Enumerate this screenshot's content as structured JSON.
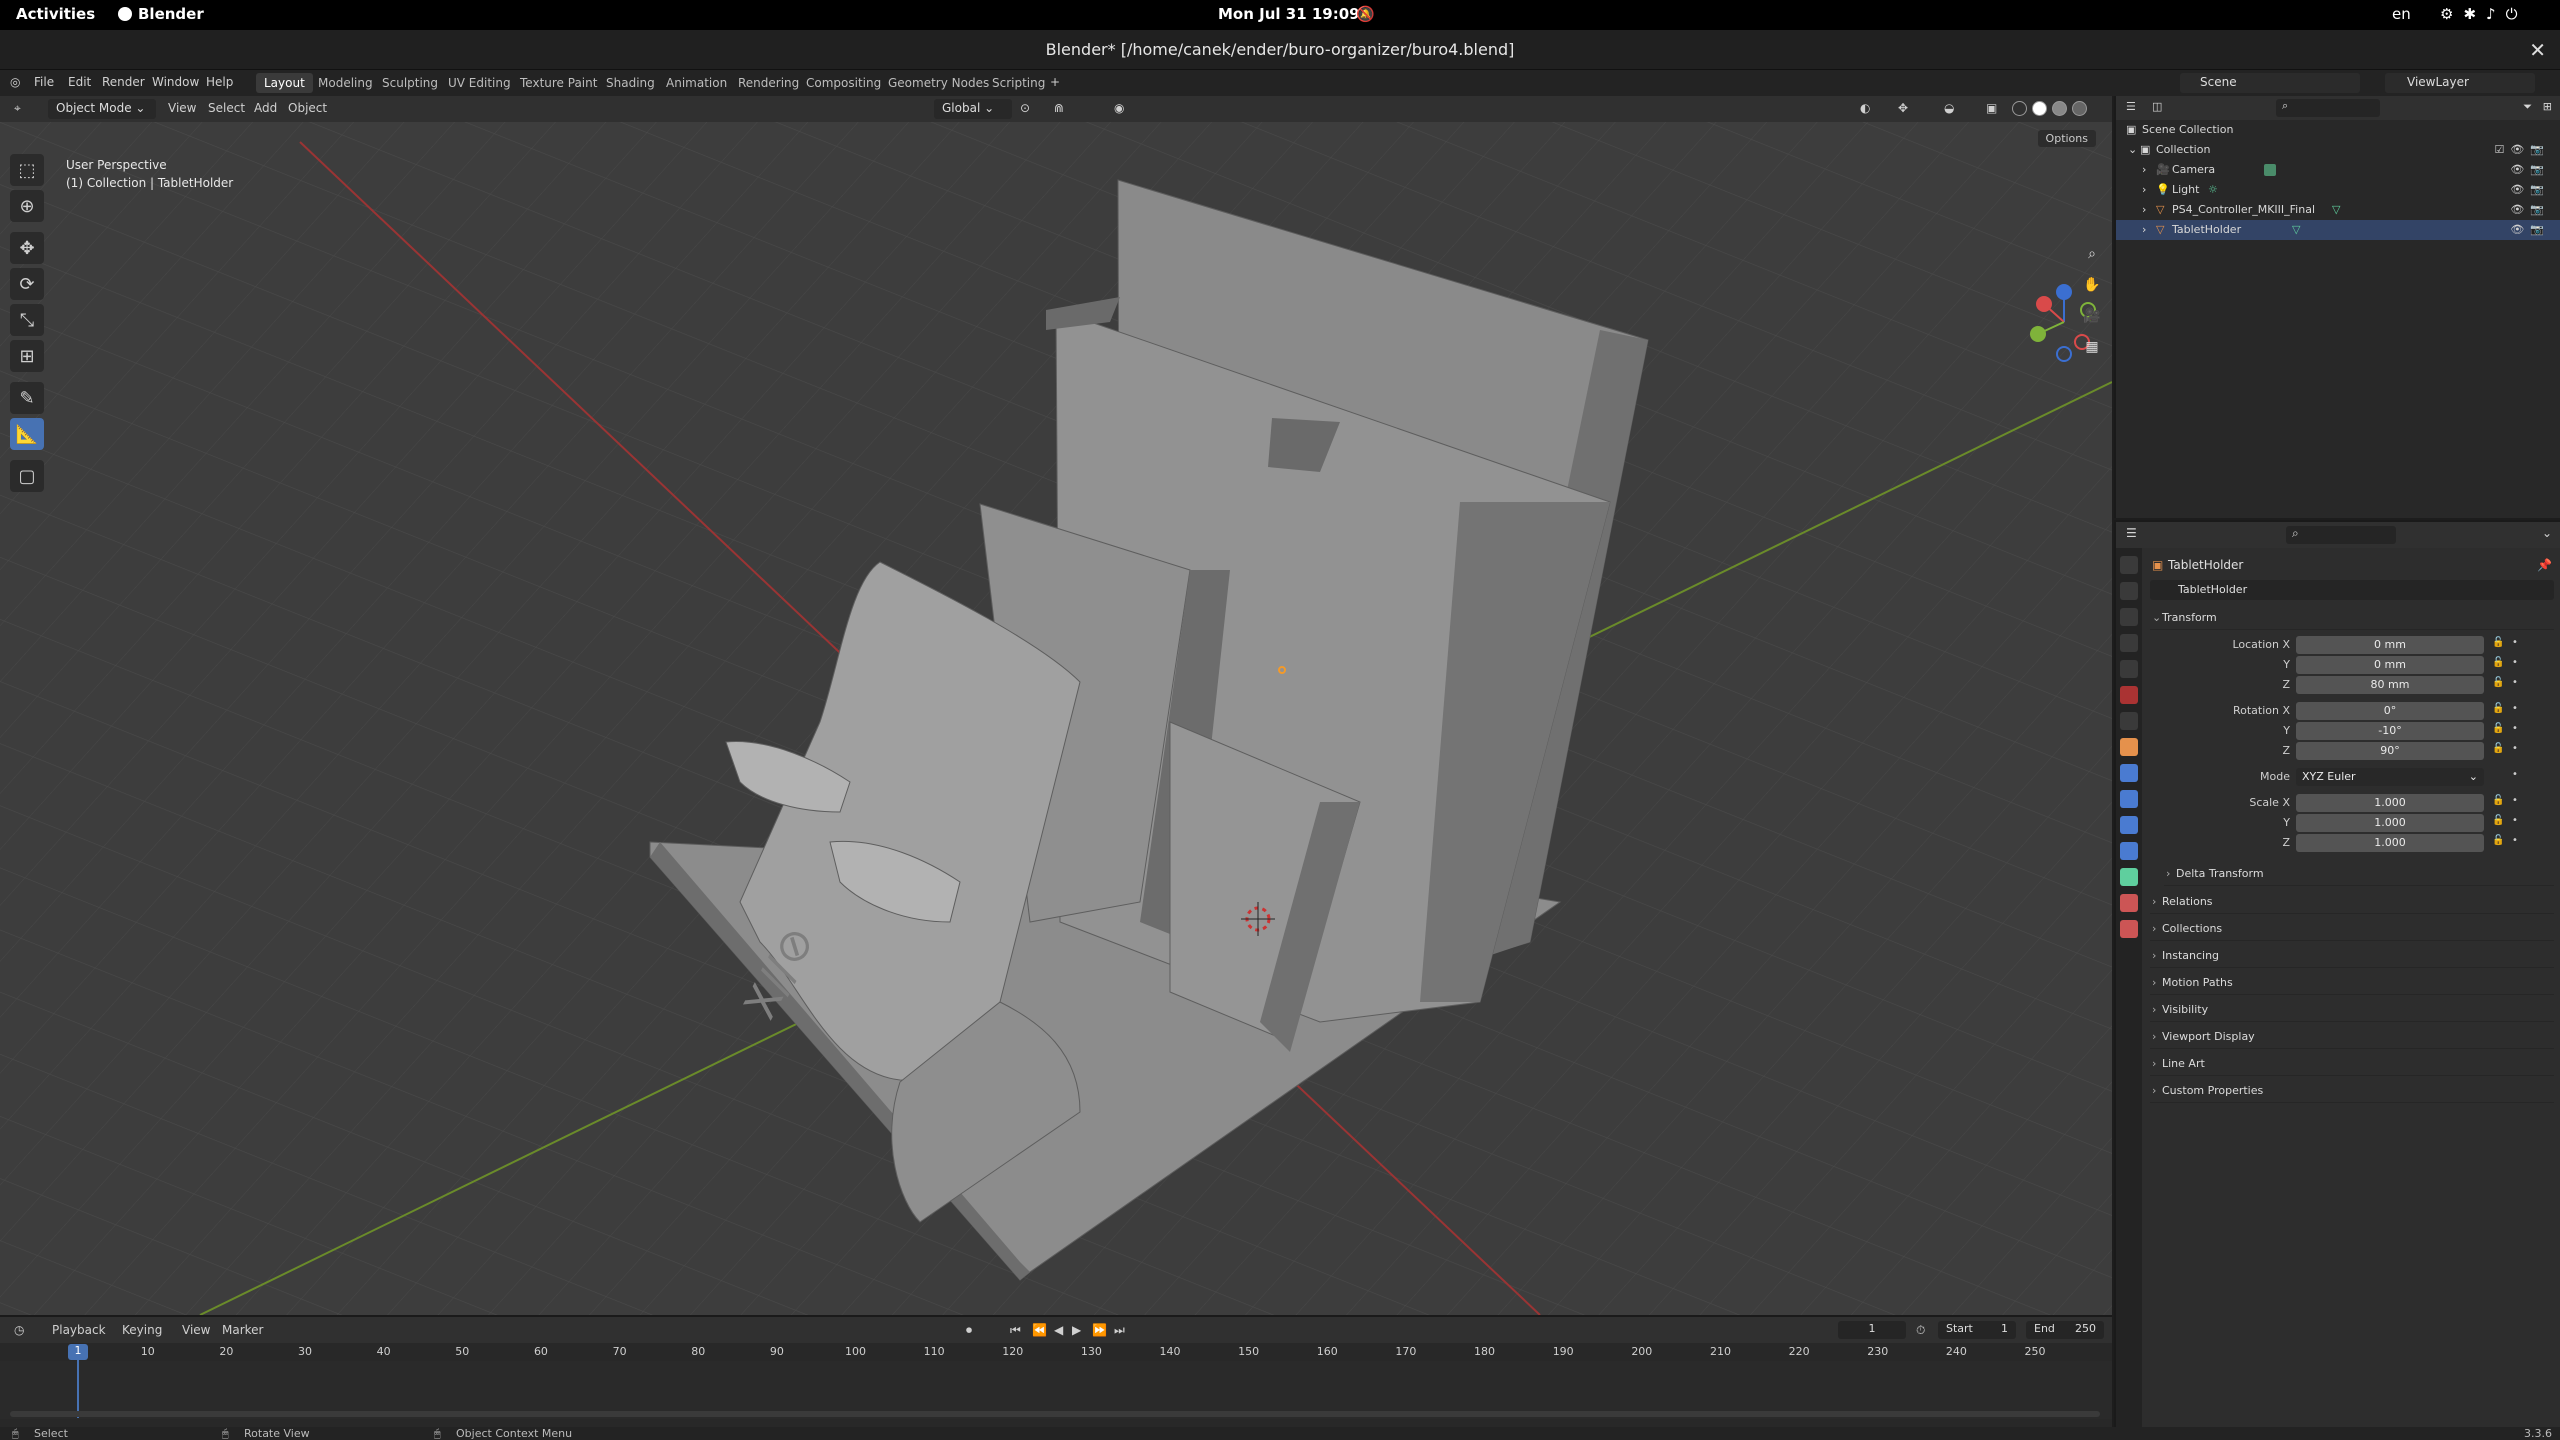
{
  "gnome": {
    "activities": "Activities",
    "app_name": "Blender",
    "clock": "Mon Jul 31  19:09",
    "lang": "en"
  },
  "window": {
    "title": "Blender* [/home/canek/ender/buro-organizer/buro4.blend]"
  },
  "menu": {
    "file": "File",
    "edit": "Edit",
    "render": "Render",
    "window": "Window",
    "help": "Help"
  },
  "workspaces": [
    "Layout",
    "Modeling",
    "Sculpting",
    "UV Editing",
    "Texture Paint",
    "Shading",
    "Animation",
    "Rendering",
    "Compositing",
    "Geometry Nodes",
    "Scripting"
  ],
  "scene": {
    "name": "Scene",
    "view_layer": "ViewLayer"
  },
  "viewport_header": {
    "mode": "Object Mode",
    "view": "View",
    "select": "Select",
    "add": "Add",
    "object": "Object",
    "orientation": "Global",
    "options": "Options"
  },
  "viewport": {
    "perspective": "User Perspective",
    "context": "(1) Collection | TabletHolder"
  },
  "tools": [
    "select-box",
    "cursor",
    "move",
    "rotate",
    "scale",
    "transform",
    "annotate",
    "measure",
    "add-cube"
  ],
  "timeline": {
    "playback": "Playback",
    "keying": "Keying",
    "view": "View",
    "marker": "Marker",
    "current_frame": "1",
    "start_label": "Start",
    "start": "1",
    "end_label": "End",
    "end": "250",
    "ticks": [
      "1",
      "10",
      "20",
      "30",
      "40",
      "50",
      "60",
      "70",
      "80",
      "90",
      "100",
      "110",
      "120",
      "130",
      "140",
      "150",
      "160",
      "170",
      "180",
      "190",
      "200",
      "210",
      "220",
      "230",
      "240",
      "250"
    ]
  },
  "status": {
    "select": "Select",
    "rotate": "Rotate View",
    "context": "Object Context Menu",
    "version": "3.3.6"
  },
  "outliner": {
    "scene_collection": "Scene Collection",
    "collection": "Collection",
    "items": [
      "Camera",
      "Light",
      "PS4_Controller_MKIII_Final",
      "TabletHolder"
    ]
  },
  "properties": {
    "object_name": "TabletHolder",
    "datablock": "TabletHolder",
    "transform_label": "Transform",
    "location_label": "Location X",
    "location": [
      "0 mm",
      "0 mm",
      "80 mm"
    ],
    "rotation_label": "Rotation X",
    "rotation": [
      "0°",
      "-10°",
      "90°"
    ],
    "mode_label": "Mode",
    "mode": "XYZ Euler",
    "scale_label": "Scale X",
    "scale": [
      "1.000",
      "1.000",
      "1.000"
    ],
    "axis_y": "Y",
    "axis_z": "Z",
    "delta": "Delta Transform",
    "panels": [
      "Relations",
      "Collections",
      "Instancing",
      "Motion Paths",
      "Visibility",
      "Viewport Display",
      "Line Art",
      "Custom Properties"
    ]
  }
}
